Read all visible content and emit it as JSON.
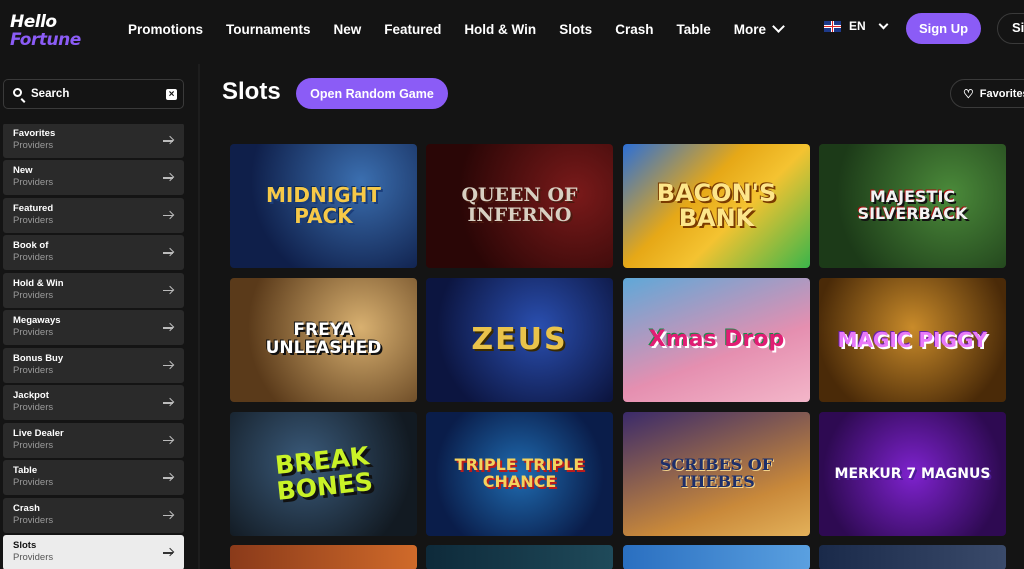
{
  "header": {
    "logo_line1": "Hello",
    "logo_line2": "Fortune",
    "nav": [
      "Promotions",
      "Tournaments",
      "New",
      "Featured",
      "Hold & Win",
      "Slots",
      "Crash",
      "Table"
    ],
    "more_label": "More",
    "language": "EN",
    "signup_label": "Sign Up",
    "signin_label": "Si"
  },
  "sidebar": {
    "search_placeholder": "Search",
    "categories": [
      {
        "title": "Favorites",
        "sub": "Providers"
      },
      {
        "title": "New",
        "sub": "Providers"
      },
      {
        "title": "Featured",
        "sub": "Providers"
      },
      {
        "title": "Book of",
        "sub": "Providers"
      },
      {
        "title": "Hold & Win",
        "sub": "Providers"
      },
      {
        "title": "Megaways",
        "sub": "Providers"
      },
      {
        "title": "Bonus Buy",
        "sub": "Providers"
      },
      {
        "title": "Jackpot",
        "sub": "Providers"
      },
      {
        "title": "Live Dealer",
        "sub": "Providers"
      },
      {
        "title": "Table",
        "sub": "Providers"
      },
      {
        "title": "Crash",
        "sub": "Providers"
      },
      {
        "title": "Slots",
        "sub": "Providers"
      }
    ],
    "active_category": "Slots"
  },
  "main": {
    "title": "Slots",
    "random_button": "Open Random Game",
    "favorites_button": "Favorites",
    "games": [
      {
        "name": "Midnight Pack"
      },
      {
        "name": "Queen of Inferno"
      },
      {
        "name": "Bacon's Bank"
      },
      {
        "name": "Majestic Silverback"
      },
      {
        "name": "Freya Unleashed"
      },
      {
        "name": "Zeus"
      },
      {
        "name": "Xmas Drop"
      },
      {
        "name": "Magic Piggy"
      },
      {
        "name": "Break Bones"
      },
      {
        "name": "Triple Triple Chance"
      },
      {
        "name": "Scribes of Thebes"
      },
      {
        "name": "Merkur 7 Magnus"
      }
    ]
  },
  "colors": {
    "accent": "#8b5cf6",
    "background": "#141414",
    "sidebar_item": "#2a2a2a",
    "sidebar_item_active": "#ececec"
  }
}
